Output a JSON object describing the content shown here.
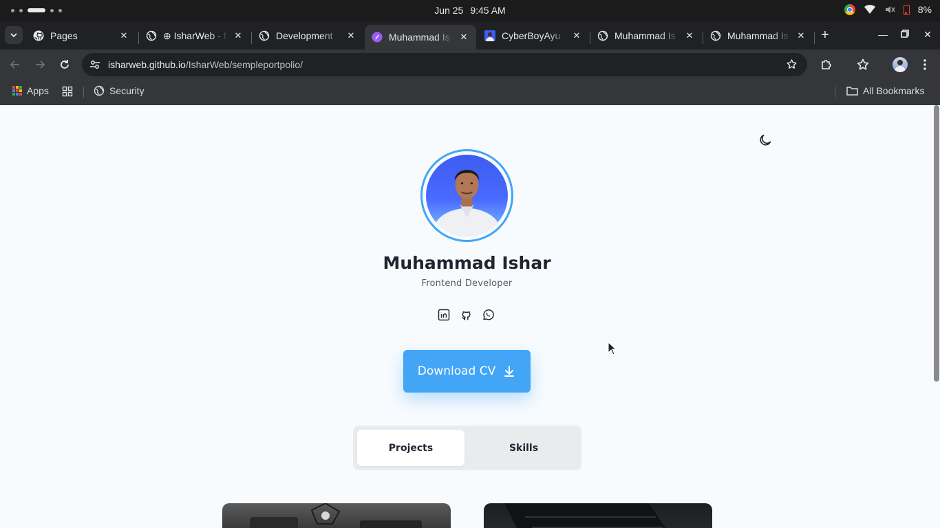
{
  "os": {
    "date": "Jun 25",
    "time": "9:45 AM",
    "battery": "8%"
  },
  "tabs": [
    {
      "label": "Pages",
      "icon": "github-icon",
      "active": false
    },
    {
      "label": "⊕ IsharWeb - f",
      "icon": "globe-icon",
      "active": false
    },
    {
      "label": "Development",
      "icon": "globe-icon",
      "active": false
    },
    {
      "label": "Muhammad Is",
      "icon": "purple-site-icon",
      "active": true
    },
    {
      "label": "CyberBoyAyu",
      "icon": "avatar-icon",
      "active": false
    },
    {
      "label": "Muhammad Is",
      "icon": "globe-icon",
      "active": false
    },
    {
      "label": "Muhammad Is",
      "icon": "globe-icon",
      "active": false
    }
  ],
  "omnibox": {
    "host": "isharweb.github.io",
    "path": "/IsharWeb/sempleportpolio/"
  },
  "bookmarks": {
    "apps": "Apps",
    "security": "Security",
    "all": "All Bookmarks"
  },
  "page": {
    "name": "Muhammad Ishar",
    "role": "Frontend Developer",
    "download_label": "Download CV",
    "tab_projects": "Projects",
    "tab_skills": "Skills",
    "accent": "#42a5f5"
  }
}
